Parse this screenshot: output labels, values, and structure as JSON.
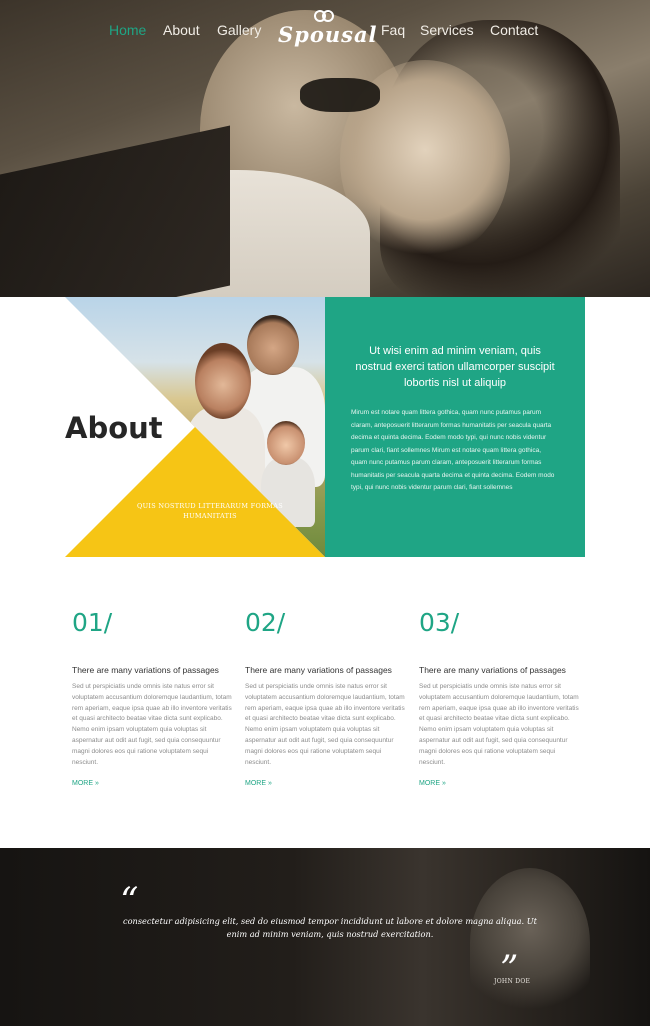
{
  "nav": {
    "items": [
      "Home",
      "About",
      "Gallery",
      "Faq",
      "Services",
      "Contact"
    ],
    "active": "Home",
    "logo": "Spousal",
    "logo_icon": "rings-icon"
  },
  "about": {
    "title": "About",
    "triangle_text": "QUIS NOSTRUD LITTERARUM FORMAS HUMANITATIS",
    "lead": "Ut wisi enim ad minim veniam, quis nostrud exerci tation ullamcorper suscipit lobortis nisl ut aliquip",
    "body": "Mirum est notare quam littera gothica, quam nunc putamus parum claram, anteposuerit litterarum formas humanitatis per seacula quarta decima et quinta decima. Eodem modo typi, qui nunc nobis videntur parum clari, fiant sollemnes Mirum est notare quam littera gothica, quam nunc putamus parum claram, anteposuerit litterarum formas humanitatis per seacula quarta decima et quinta decima. Eodem modo typi, qui nunc nobis videntur parum clari, fiant sollemnes"
  },
  "features": [
    {
      "number": "01/",
      "heading": "There are many variations of passages",
      "text": "Sed ut perspiciatis unde omnis iste natus error sit voluptatem accusantium doloremque laudantium, totam rem aperiam, eaque ipsa quae ab illo inventore veritatis et quasi architecto beatae vitae dicta sunt explicabo. Nemo enim ipsam voluptatem quia voluptas sit aspernatur aut odit aut fugit, sed quia consequuntur magni dolores eos qui ratione voluptatem sequi nesciunt.",
      "more": "MORE »"
    },
    {
      "number": "02/",
      "heading": "There are many variations of passages",
      "text": "Sed ut perspiciatis unde omnis iste natus error sit voluptatem accusantium doloremque laudantium, totam rem aperiam, eaque ipsa quae ab illo inventore veritatis et quasi architecto beatae vitae dicta sunt explicabo. Nemo enim ipsam voluptatem quia voluptas sit aspernatur aut odit aut fugit, sed quia consequuntur magni dolores eos qui ratione voluptatem sequi nesciunt.",
      "more": "MORE »"
    },
    {
      "number": "03/",
      "heading": "There are many variations of passages",
      "text": "Sed ut perspiciatis unde omnis iste natus error sit voluptatem accusantium doloremque laudantium, totam rem aperiam, eaque ipsa quae ab illo inventore veritatis et quasi architecto beatae vitae dicta sunt explicabo. Nemo enim ipsam voluptatem quia voluptas sit aspernatur aut odit aut fugit, sed quia consequuntur magni dolores eos qui ratione voluptatem sequi nesciunt.",
      "more": "MORE »"
    }
  ],
  "testimonial": {
    "quote": "consectetur adipisicing elit, sed do eiusmod tempor incididunt ut labore et dolore magna aliqua. Ut enim ad minim veniam, quis nostrud exercitation.",
    "open_mark": "“",
    "close_mark": "”",
    "author": "JOHN DOE"
  },
  "colors": {
    "accent": "#1fa585",
    "yellow": "#f6c515",
    "dark": "#1c1a17"
  }
}
